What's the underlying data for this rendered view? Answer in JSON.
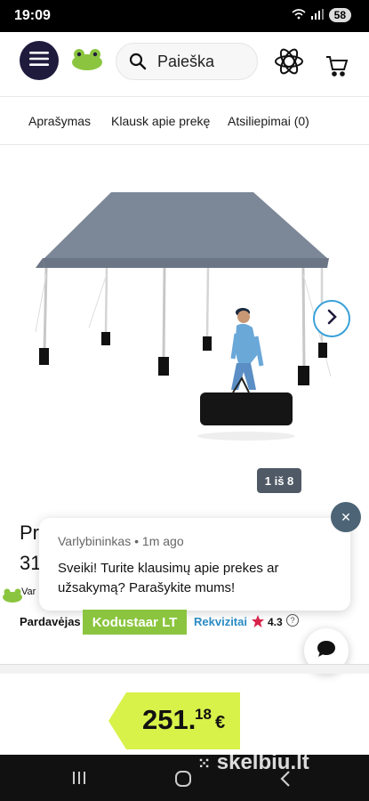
{
  "status": {
    "time": "19:09",
    "battery": "58"
  },
  "header": {
    "search_placeholder": "Paieška"
  },
  "tabs": [
    {
      "label": "Aprašymas"
    },
    {
      "label": "Klausk apie prekę"
    },
    {
      "label": "Atsiliepimai (0)"
    }
  ],
  "gallery": {
    "counter": "1 iš 8"
  },
  "product": {
    "title_fragment": "Pr",
    "price_fragment": "31",
    "seller_fragment": "Var"
  },
  "chat": {
    "meta": "Varlybininkas • 1m ago",
    "message": "Sveiki! Turite klausimų apie prekes ar užsakymą? Parašykite mums!",
    "close_label": "✕"
  },
  "seller": {
    "label": "Pardavėjas",
    "name": "Kodustaar LT",
    "requisites": "Rekvizitai",
    "rating": "4.3",
    "help": "?"
  },
  "price": {
    "whole": "251.",
    "cents": "18",
    "currency": "€"
  },
  "watermark": {
    "text": "skelbiu.lt"
  },
  "colors": {
    "menu_dark": "#1f1b3d",
    "seller_green": "#8bc53f",
    "price_yellow": "#d8f24a",
    "link_blue": "#2a8bc4",
    "star": "#d8234a"
  }
}
